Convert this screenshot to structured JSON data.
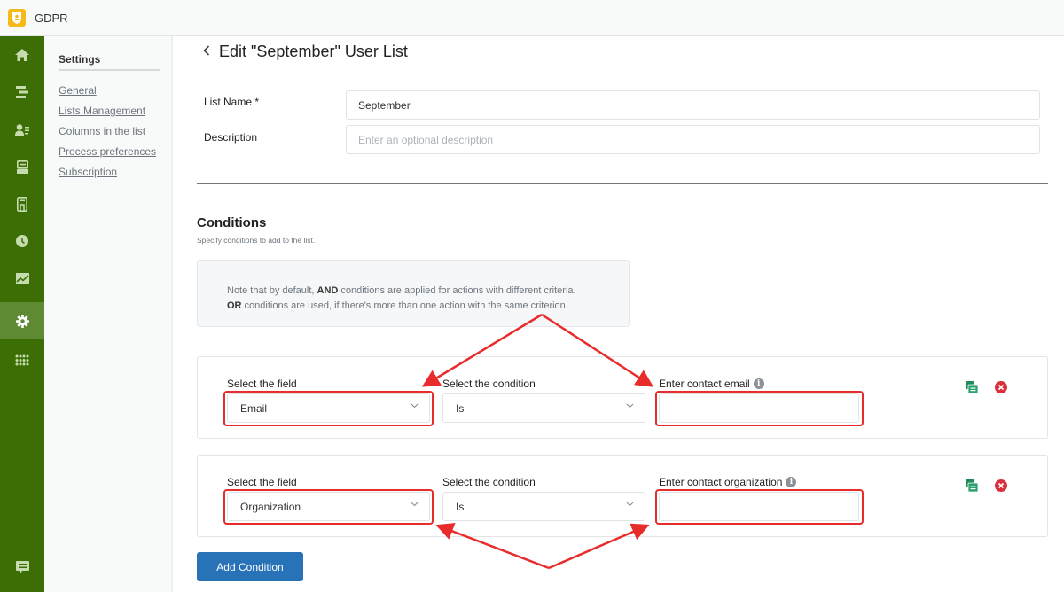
{
  "app": {
    "title": "GDPR",
    "logo_icon": "shield-user-icon",
    "logo_color": "#f5b919"
  },
  "rail": {
    "color": "#3b6e04",
    "active_color": "#5d8a33",
    "items": [
      {
        "icon": "home-icon",
        "active": false
      },
      {
        "icon": "lists-icon",
        "active": false
      },
      {
        "icon": "contacts-icon",
        "active": false
      },
      {
        "icon": "inbox-icon",
        "active": false
      },
      {
        "icon": "document-icon",
        "active": false
      },
      {
        "icon": "clock-icon",
        "active": false
      },
      {
        "icon": "chart-icon",
        "active": false
      },
      {
        "icon": "gear-icon",
        "active": true
      },
      {
        "icon": "apps-grid-icon",
        "active": false
      }
    ],
    "bottom_icon": "chat-icon"
  },
  "subnav": {
    "title": "Settings",
    "links": [
      "General",
      "Lists Management",
      "Columns in the list",
      "Process preferences",
      "Subscription"
    ]
  },
  "page": {
    "back_icon": "chevron-left-icon",
    "title": "Edit \"September\" User List"
  },
  "form": {
    "list_name_label": "List Name *",
    "list_name_value": "September",
    "description_label": "Description",
    "description_placeholder": "Enter an optional description"
  },
  "conditions": {
    "title": "Conditions",
    "subtitle": "Specify conditions to add to the list.",
    "note_line1_pre": "Note that by default, ",
    "note_line1_bold": "AND",
    "note_line1_post": " conditions are applied for actions with different criteria.",
    "note_line2_bold": "OR",
    "note_line2_post": " conditions are used, if there's more than one action with the same criterion.",
    "rows": [
      {
        "field_label": "Select the field",
        "field_value": "Email",
        "condition_label": "Select the condition",
        "condition_value": "Is",
        "value_label": "Enter contact email",
        "value": ""
      },
      {
        "field_label": "Select the field",
        "field_value": "Organization",
        "condition_label": "Select the condition",
        "condition_value": "Is",
        "value_label": "Enter contact organization",
        "value": ""
      }
    ],
    "info_glyph": "i",
    "copy_color": "#1e8c5a",
    "delete_color": "#d9303e",
    "add_button": "Add Condition",
    "add_button_color": "#2872b8"
  },
  "annotation_color": "#e82c2c"
}
